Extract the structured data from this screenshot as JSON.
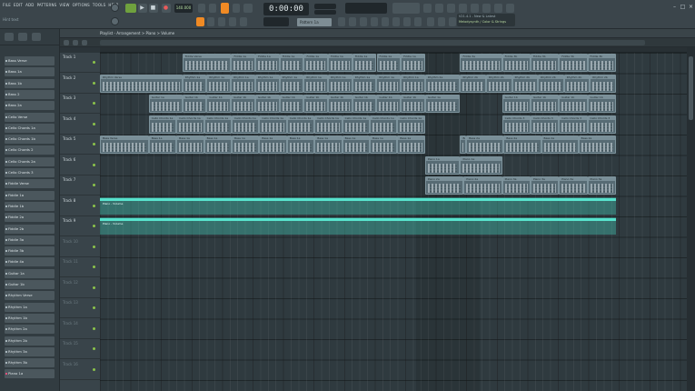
{
  "menu": [
    "FILE",
    "EDIT",
    "ADD",
    "PATTERNS",
    "VIEW",
    "OPTIONS",
    "TOOLS",
    "HELP"
  ],
  "hint_text": "Hint text",
  "tempo": "140.000",
  "time_display": "0:00:00",
  "pattern_name": "Pattern 1a",
  "news": {
    "line1": "V21.4.1 - New & Latest",
    "line2": "Melodysynth / Color & Strings"
  },
  "playlist_title": "Playlist - Arrangement > Piano > Volume",
  "browser_items": [
    {
      "label": "Bass Verse",
      "selected": false
    },
    {
      "label": "Bass 1a",
      "selected": false
    },
    {
      "label": "Bass 1b",
      "selected": false
    },
    {
      "label": "Bass 2",
      "selected": false
    },
    {
      "label": "Bass 2a",
      "selected": false
    },
    {
      "label": "Cello Verse",
      "selected": false
    },
    {
      "label": "Cello Chords 1a",
      "selected": false
    },
    {
      "label": "Cello Chords 1b",
      "selected": false
    },
    {
      "label": "Cello Chords 2",
      "selected": false
    },
    {
      "label": "Cello Chords 2a",
      "selected": false
    },
    {
      "label": "Cello Chords 3",
      "selected": false
    },
    {
      "label": "Fiddle Verse",
      "selected": false
    },
    {
      "label": "Fiddle 1a",
      "selected": false
    },
    {
      "label": "Fiddle 1b",
      "selected": false
    },
    {
      "label": "Fiddle 2a",
      "selected": false
    },
    {
      "label": "Fiddle 2b",
      "selected": false
    },
    {
      "label": "Fiddle 3a",
      "selected": false
    },
    {
      "label": "Fiddle 3b",
      "selected": false
    },
    {
      "label": "Fiddle 4a",
      "selected": false
    },
    {
      "label": "Guitar 1a",
      "selected": false
    },
    {
      "label": "Guitar 1b",
      "selected": false
    },
    {
      "label": "Rhythm Verse",
      "selected": false
    },
    {
      "label": "Rhythm 1a",
      "selected": false
    },
    {
      "label": "Rhythm 1b",
      "selected": false
    },
    {
      "label": "Rhythm 2a",
      "selected": false
    },
    {
      "label": "Rhythm 2b",
      "selected": false
    },
    {
      "label": "Rhythm 3a",
      "selected": false
    },
    {
      "label": "Rhythm 3b",
      "selected": false
    },
    {
      "label": "Piano 1a",
      "selected": true
    }
  ],
  "tracks": [
    "Track 1",
    "Track 2",
    "Track 3",
    "Track 4",
    "Track 5",
    "Track 6",
    "Track 7",
    "Track 8",
    "Track 9",
    "Track 10",
    "Track 11",
    "Track 12",
    "Track 13",
    "Track 14",
    "Track 15",
    "Track 16"
  ],
  "automation_label": "Piano - Volume",
  "clips": [
    {
      "track": 0,
      "items": [
        {
          "label": "Fiddle Verse",
          "s": 10.8,
          "e": 17.2
        },
        {
          "label": "Fiddle 1a",
          "s": 17.2,
          "e": 42.6,
          "repeat": 8
        },
        {
          "label": "Fiddle 3a",
          "s": 47.2,
          "e": 52.7
        },
        {
          "label": "Fiddle 3b",
          "s": 52.7,
          "e": 67.6,
          "repeat": 4
        }
      ]
    },
    {
      "track": 1,
      "items": [
        {
          "label": "Rhythm Verse",
          "s": 0.0,
          "e": 10.8
        },
        {
          "label": "Rhythm 1a",
          "s": 10.8,
          "e": 42.6,
          "repeat": 10
        },
        {
          "label": "Rhythm 2a",
          "s": 42.6,
          "e": 47.2
        },
        {
          "label": "Rhythm 2b",
          "s": 47.2,
          "e": 67.6,
          "repeat": 6
        }
      ]
    },
    {
      "track": 2,
      "items": [
        {
          "label": "Guitar 1a",
          "s": 6.4,
          "e": 10.8
        },
        {
          "label": "Guitar 1b",
          "s": 10.8,
          "e": 42.6,
          "repeat": 10
        },
        {
          "label": "Guitar 1a",
          "s": 42.6,
          "e": 47.2
        },
        {
          "label": "Guitar 1b",
          "s": 52.7,
          "e": 67.6,
          "repeat": 4
        }
      ]
    },
    {
      "track": 3,
      "items": [
        {
          "label": "Cello Chords 1a",
          "s": 6.4,
          "e": 42.6,
          "repeat": 10
        },
        {
          "label": "Cello Chords 3",
          "s": 52.7,
          "e": 67.6,
          "repeat": 4
        }
      ]
    },
    {
      "track": 4,
      "items": [
        {
          "label": "Bass Verse",
          "s": 0.0,
          "e": 6.4
        },
        {
          "label": "Bass 1a",
          "s": 6.4,
          "e": 42.6,
          "repeat": 10
        },
        {
          "label": "Bass 2",
          "s": 47.2,
          "e": 48.0
        },
        {
          "label": "Bass 2a",
          "s": 48.0,
          "e": 67.6,
          "repeat": 4
        }
      ]
    },
    {
      "track": 5,
      "items": [
        {
          "label": "Piano 1a",
          "s": 42.6,
          "e": 47.2
        },
        {
          "label": "Piano 1a",
          "s": 47.2,
          "e": 52.7
        }
      ]
    },
    {
      "track": 6,
      "items": [
        {
          "label": "Piano 2a",
          "s": 42.6,
          "e": 52.7,
          "repeat": 2
        },
        {
          "label": "Piano 3a",
          "s": 52.7,
          "e": 67.6,
          "repeat": 4
        }
      ]
    }
  ],
  "automation": [
    {
      "track": 7,
      "s": 0.0,
      "e": 67.6
    },
    {
      "track": 8,
      "s": 0.0,
      "e": 67.6
    }
  ]
}
